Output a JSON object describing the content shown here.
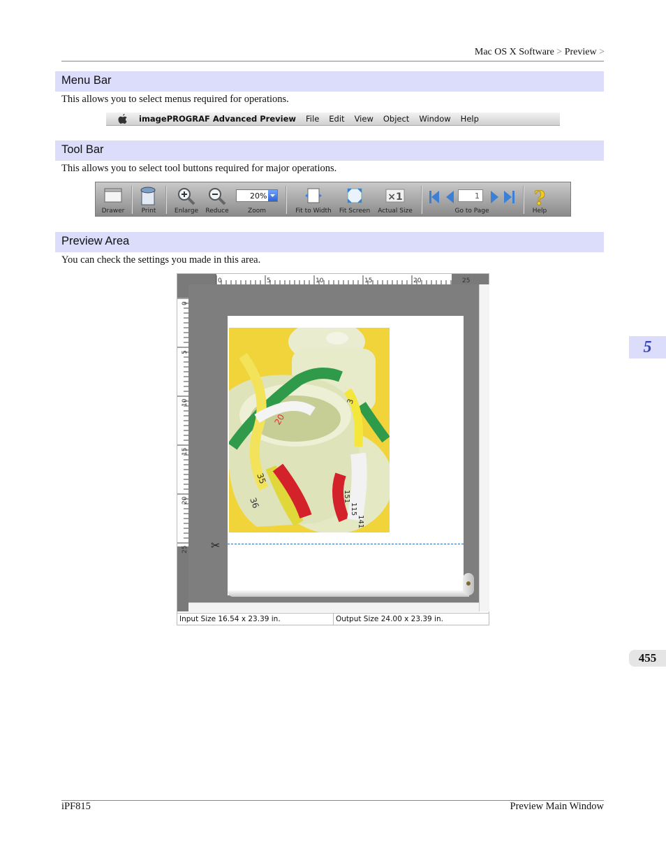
{
  "header": {
    "breadcrumb": [
      "Mac OS X Software",
      "Preview"
    ],
    "separator": ">"
  },
  "sections": {
    "menu_bar": {
      "title": "Menu Bar",
      "description": "This allows you to select menus required for operations."
    },
    "tool_bar": {
      "title": "Tool Bar",
      "description": "This allows you to select tool buttons required for major operations."
    },
    "preview_area": {
      "title": "Preview Area",
      "description": "You can check the settings you made in this area."
    }
  },
  "menubar": {
    "app_name": "imagePROGRAF Advanced Preview",
    "items": [
      "File",
      "Edit",
      "View",
      "Object",
      "Window",
      "Help"
    ]
  },
  "toolbar": {
    "drawer": "Drawer",
    "print": "Print",
    "enlarge": "Enlarge",
    "reduce": "Reduce",
    "zoom": "Zoom",
    "zoom_value": "20%",
    "fit_to_width": "Fit to Width",
    "fit_screen": "Fit Screen",
    "actual_size": "Actual Size",
    "actual_size_glyph": "×1",
    "go_to_page": "Go to Page",
    "page_value": "1",
    "help": "Help"
  },
  "preview": {
    "ruler_h": [
      "0",
      "5",
      "10",
      "15",
      "20",
      "25"
    ],
    "ruler_v": [
      "0",
      "5",
      "10",
      "15",
      "20",
      "25"
    ],
    "tape_numbers": [
      "20",
      "35",
      "36",
      "3",
      "151",
      "115",
      "141"
    ],
    "status_input": "Input Size 16.54 x 23.39 in.",
    "status_output": "Output Size 24.00 x 23.39 in."
  },
  "side_tabs": {
    "chapter": "5",
    "page": "455"
  },
  "footer": {
    "left": "iPF815",
    "right": "Preview Main Window"
  },
  "colors": {
    "section_bar": "#dcdcfb",
    "chapter_text": "#3846b8",
    "cut_line": "#2b6cb3"
  }
}
